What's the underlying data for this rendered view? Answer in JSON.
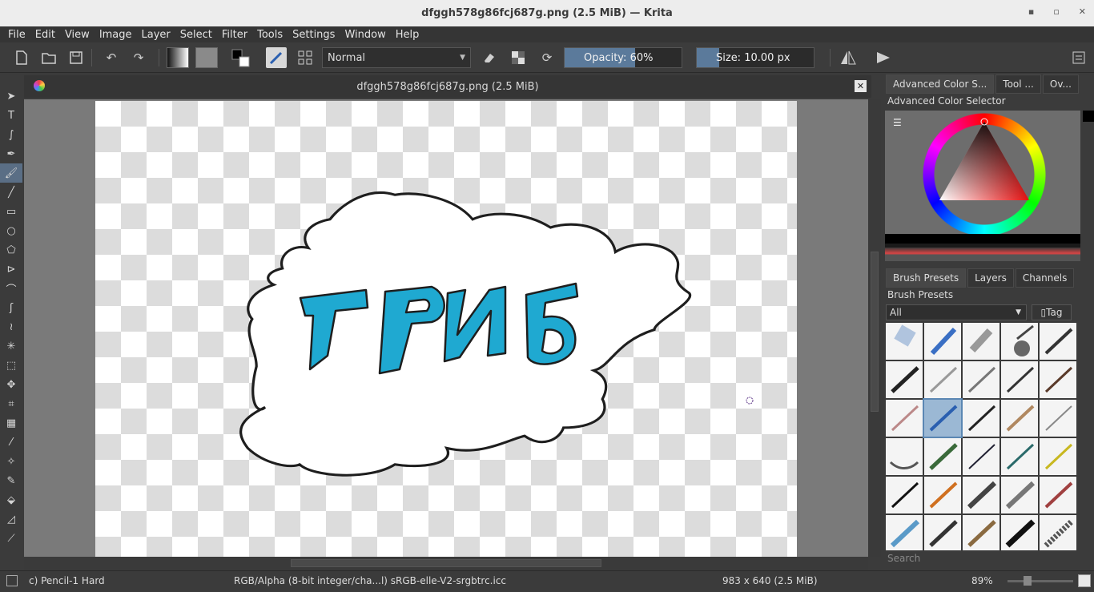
{
  "window": {
    "title": "dfggh578g86fcj687g.png (2.5 MiB)  — Krita",
    "controls": [
      "▪",
      "▫",
      "✕"
    ]
  },
  "menu": [
    "File",
    "Edit",
    "View",
    "Image",
    "Layer",
    "Select",
    "Filter",
    "Tools",
    "Settings",
    "Window",
    "Help"
  ],
  "toolbar": {
    "blend_mode": "Normal",
    "opacity_label": "Opacity:",
    "opacity_value": "60%",
    "opacity_fraction": 0.6,
    "size_label": "Size:",
    "size_value": "10.00 px"
  },
  "document": {
    "tab_title": "dfggh578g86fcj687g.png (2.5 MiB)",
    "drawn_text": "ГРИБ"
  },
  "dock": {
    "top_tabs": [
      "Advanced Color S...",
      "Tool ...",
      "Ov..."
    ],
    "color_selector_title": "Advanced Color Selector",
    "bottom_tabs": [
      "Brush Presets",
      "Layers",
      "Channels"
    ],
    "presets_title": "Brush Presets",
    "filter_value": "All",
    "tag_label": "Tag",
    "search_placeholder": "Search"
  },
  "status": {
    "brush": "c) Pencil-1 Hard",
    "color_space": "RGB/Alpha (8-bit integer/cha...l)  sRGB-elle-V2-srgbtrc.icc",
    "dimensions": "983 x 640 (2.5 MiB)",
    "zoom": "89%"
  },
  "colors": {
    "accent": "#5b7a9b",
    "letters": "#1fa9d1",
    "outline": "#1e1e1e"
  }
}
